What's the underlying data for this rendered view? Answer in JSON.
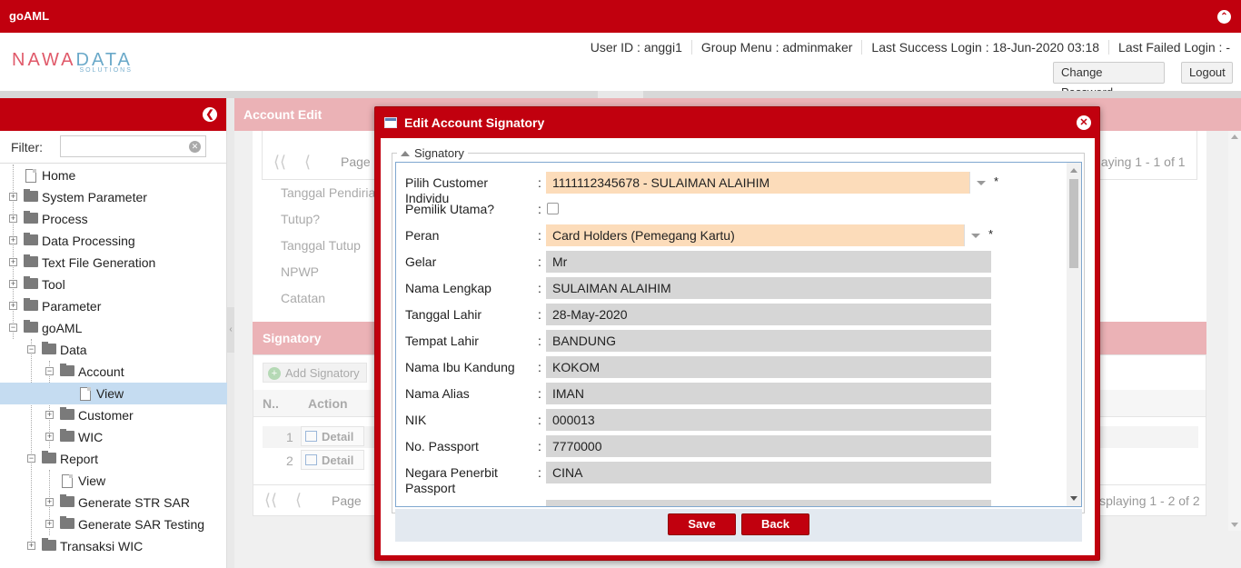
{
  "app": {
    "title": "goAML"
  },
  "logo": {
    "main_a": "NAWA",
    "main_b": "DATA",
    "sub": "SOLUTIONS"
  },
  "user": {
    "user_id": "User ID : anggi1",
    "group_menu": "Group Menu : adminmaker",
    "last_success": "Last Success Login : 18-Jun-2020 03:18",
    "last_failed": "Last Failed Login : -",
    "change_password": "Change Password",
    "logout": "Logout"
  },
  "sidebar": {
    "filter_label": "Filter:",
    "filter_value": "",
    "items": [
      {
        "label": "Home"
      },
      {
        "label": "System Parameter"
      },
      {
        "label": "Process"
      },
      {
        "label": "Data Processing"
      },
      {
        "label": "Text File Generation"
      },
      {
        "label": "Tool"
      },
      {
        "label": "Parameter"
      },
      {
        "label": "goAML"
      },
      {
        "label": "Data"
      },
      {
        "label": "Account"
      },
      {
        "label": "View"
      },
      {
        "label": "Customer"
      },
      {
        "label": "WIC"
      },
      {
        "label": "Report"
      },
      {
        "label": "View"
      },
      {
        "label": "Generate STR SAR"
      },
      {
        "label": "Generate SAR Testing"
      },
      {
        "label": "Transaksi WIC"
      }
    ]
  },
  "main": {
    "account_edit_title": "Account Edit",
    "top_pager": {
      "page_label": "Page",
      "display": "playing 1 - 1 of 1"
    },
    "form_labels": [
      "Tanggal Pendirian",
      "Tutup?",
      "Tanggal Tutup",
      "NPWP",
      "Catatan"
    ],
    "signatory_title": "Signatory",
    "add_signatory": "Add Signatory",
    "columns": [
      "N..",
      "Action"
    ],
    "rows": [
      {
        "no": "1",
        "action": "Detail"
      },
      {
        "no": "2",
        "action": "Detail"
      }
    ],
    "bottom_pager": {
      "page_label": "Page",
      "display": "isplaying 1 - 2 of 2"
    }
  },
  "modal": {
    "title": "Edit Account Signatory",
    "legend": "Signatory",
    "fields": [
      {
        "label": "Pilih Customer Individu",
        "value": "1111112345678 - SULAIMAN ALAIHIM",
        "type": "combo",
        "required": "*"
      },
      {
        "label": "Pemilik Utama?",
        "value": "",
        "type": "checkbox"
      },
      {
        "label": "Peran",
        "value": "Card Holders (Pemegang Kartu)",
        "type": "combo",
        "required": "*"
      },
      {
        "label": "Gelar",
        "value": "Mr",
        "type": "text"
      },
      {
        "label": "Nama Lengkap",
        "value": "SULAIMAN ALAIHIM",
        "type": "text"
      },
      {
        "label": "Tanggal Lahir",
        "value": "28-May-2020",
        "type": "text"
      },
      {
        "label": "Tempat Lahir",
        "value": "BANDUNG",
        "type": "text"
      },
      {
        "label": "Nama Ibu Kandung",
        "value": "KOKOM",
        "type": "text"
      },
      {
        "label": "Nama Alias",
        "value": "IMAN",
        "type": "text"
      },
      {
        "label": "NIK",
        "value": "000013",
        "type": "text"
      },
      {
        "label": "No. Passport",
        "value": "7770000",
        "type": "text"
      },
      {
        "label": "Negara Penerbit Passport",
        "value": "CINA",
        "type": "text"
      }
    ],
    "save_label": "Save",
    "back_label": "Back"
  },
  "colors": {
    "brand": "#c1000e",
    "header_faded": "#ebb2b6",
    "combo_bg": "#fcdcba",
    "readonly_bg": "#d6d6d6"
  }
}
